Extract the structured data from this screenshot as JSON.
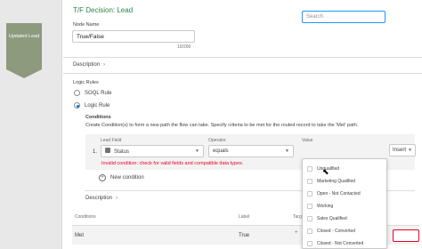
{
  "node": {
    "label": "Updated Lead"
  },
  "panel": {
    "title": "T/F Decision: Lead",
    "node_name_label": "Node Name",
    "node_name_value": "True/False",
    "char_count": "10/200",
    "description_label": "Description",
    "logic_rules_label": "Logic Rules",
    "rule_options": [
      "SOQL Rule",
      "Logic Rule"
    ],
    "conditions_title": "Conditions",
    "conditions_help": "Create Condition(s) to form a new path the flow can take. Specify criteria to be met for the routed record to take the 'Met' path.",
    "condition": {
      "row_number": "1.",
      "lead_field_label": "Lead Field",
      "lead_field_value": "Status",
      "operator_label": "Operator",
      "operator_value": "equals",
      "value_label": "Value",
      "value_placeholder": "Search",
      "insert_label": "Insert"
    },
    "error_message": "Invalid condition: check for valid fields and compatible data types.",
    "new_condition_label": "New condition",
    "description2_label": "Description",
    "table": {
      "headers": [
        "Conditions",
        "Label",
        "Targ"
      ],
      "row": {
        "condition": "Met",
        "label": "True"
      }
    }
  },
  "dropdown": {
    "options": [
      "Unqualified",
      "Marketing Qualified",
      "Open - Not Contacted",
      "Working",
      "Sales Qualified",
      "Closed - Converted",
      "Closed - Not Converted"
    ]
  },
  "icons": {
    "chevron": "chevron-right-icon",
    "caret": "chevron-down-icon",
    "plus": "plus-icon",
    "cursor": "pointer-cursor-icon"
  },
  "colors": {
    "title_green": "#2e844a",
    "error_red": "#ea001e",
    "focus_blue": "#1b96ff",
    "node_olive": "#8d9a7e"
  }
}
